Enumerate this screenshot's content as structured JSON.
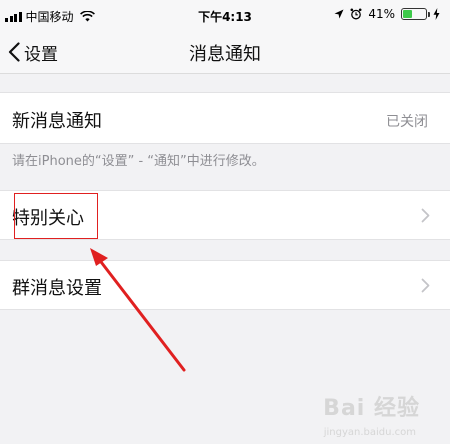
{
  "status_bar": {
    "carrier": "中国移动",
    "time": "下午4:13",
    "battery_percent": "41%",
    "battery_level": 0.41,
    "colors": {
      "battery": "#3dc94a"
    }
  },
  "nav": {
    "back_label": "设置",
    "title": "消息通知"
  },
  "settings": {
    "new_message": {
      "label": "新消息通知",
      "value": "已关闭"
    },
    "hint": "请在iPhone的“设置” - “通知”中进行修改。",
    "special_care": {
      "label": "特别关心"
    },
    "group_message": {
      "label": "群消息设置"
    }
  },
  "annotation": {
    "color": "#e02020"
  },
  "watermark": {
    "text": "Bai 经验",
    "sub": "jingyan.baidu.com"
  }
}
